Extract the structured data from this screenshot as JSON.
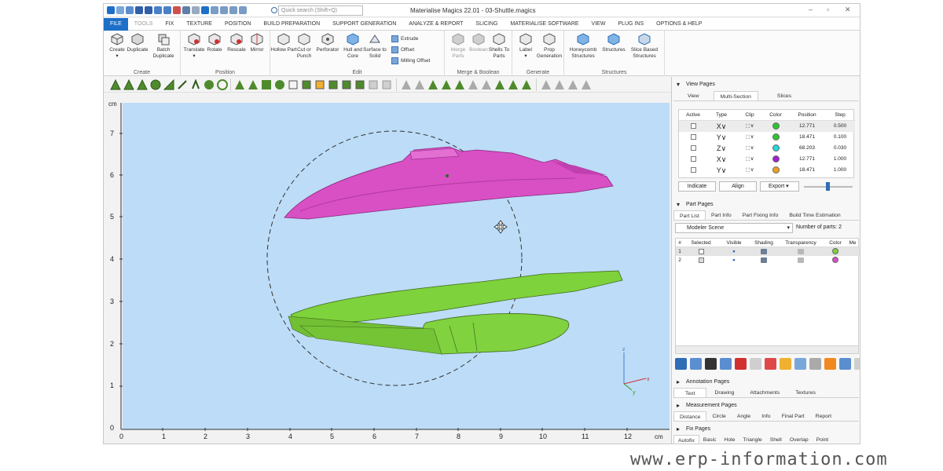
{
  "window": {
    "title": "Materialise Magics 22.01 - 03-Shuttle.magics",
    "search_placeholder": "Quick search (Shift+Q)",
    "minimize": "–",
    "maximize": "▫",
    "close": "✕"
  },
  "ribbon_tabs": [
    "FILE",
    "TOOLS",
    "FIX",
    "TEXTURE",
    "POSITION",
    "BUILD PREPARATION",
    "SUPPORT GENERATION",
    "ANALYZE & REPORT",
    "SLICING",
    "MATERIALISE SOFTWARE",
    "VIEW",
    "PLUG INS",
    "OPTIONS & HELP"
  ],
  "ribbon": {
    "create": {
      "label": "Create",
      "buttons": [
        "Create",
        "Duplicate",
        "Batch Duplicate"
      ]
    },
    "position": {
      "label": "Position",
      "buttons": [
        "Translate",
        "Rotate",
        "Rescale",
        "Mirror"
      ]
    },
    "edit": {
      "label": "Edit",
      "buttons": [
        "Hollow Part",
        "Cut or Punch",
        "Perforator",
        "Hull and Core",
        "Surface to Solid"
      ],
      "small_buttons": [
        "Extrude",
        "Offset",
        "Milling Offset"
      ]
    },
    "merge": {
      "label": "Merge & Boolean",
      "buttons": [
        "Merge Parts",
        "Boolean",
        "Shells To Parts"
      ]
    },
    "generate": {
      "label": "Generate",
      "buttons": [
        "Label",
        "Prop Generation"
      ]
    },
    "structures": {
      "label": "Structures",
      "buttons": [
        "Honeycomb Structures",
        "Structures",
        "Slice Based Structures"
      ]
    }
  },
  "viewport": {
    "y_unit": "cm",
    "x_unit": "cm",
    "y_ticks": [
      "0",
      "1",
      "2",
      "3",
      "4",
      "5",
      "6",
      "7"
    ],
    "x_ticks": [
      "0",
      "1",
      "2",
      "3",
      "4",
      "5",
      "6",
      "7",
      "8",
      "9",
      "10",
      "11",
      "12"
    ],
    "axis_z": "z",
    "axis_x": "x",
    "axis_y": "y",
    "colors": {
      "background": "#bcdcf7",
      "top_part": "#d94fc4",
      "bottom_part": "#7ed23b"
    }
  },
  "view_pages": {
    "header": "View Pages",
    "tabs": [
      "View",
      "Multi-Section",
      "Slices"
    ],
    "active_tab": "Multi-Section",
    "columns": [
      "Active",
      "Type",
      "Clip",
      "Color",
      "Position",
      "Step"
    ],
    "rows": [
      {
        "type": "X∨",
        "color": "#2fc52f",
        "position": "12.771",
        "step": "0.500"
      },
      {
        "type": "Y∨",
        "color": "#2fc52f",
        "position": "18.471",
        "step": "0.100"
      },
      {
        "type": "Z∨",
        "color": "#22d8d8",
        "position": "68.203",
        "step": "0.030"
      },
      {
        "type": "X∨",
        "color": "#a020d0",
        "position": "12.771",
        "step": "1.000"
      },
      {
        "type": "Y∨",
        "color": "#f0a020",
        "position": "18.471",
        "step": "1.000"
      }
    ],
    "buttons": [
      "Indicate",
      "Align",
      "Export"
    ]
  },
  "part_pages": {
    "header": "Part Pages",
    "tabs": [
      "Part List",
      "Part Info",
      "Part Fixing Info",
      "Build Time Estimation"
    ],
    "scene": "Modeler Scene",
    "number_of_parts_label": "Number of parts: 2",
    "columns": [
      "#",
      "Selected",
      "Visible",
      "Shading",
      "Transparency",
      "Color",
      "Me"
    ],
    "rows": [
      {
        "index": "1",
        "color": "#7ed23b"
      },
      {
        "index": "2",
        "color": "#d94fc4"
      }
    ]
  },
  "annotation_pages": {
    "header": "Annotation Pages",
    "tabs": [
      "Text",
      "Drawing",
      "Attachments",
      "Textures"
    ]
  },
  "measurement_pages": {
    "header": "Measurement Pages",
    "tabs": [
      "Distance",
      "Circle",
      "Angle",
      "Info",
      "Final Part",
      "Report"
    ]
  },
  "fix_pages": {
    "header": "Fix Pages",
    "tabs": [
      "Autofix",
      "Basic",
      "Hole",
      "Triangle",
      "Shell",
      "Overlap",
      "Point"
    ]
  },
  "watermark": "www.erp-information.com"
}
